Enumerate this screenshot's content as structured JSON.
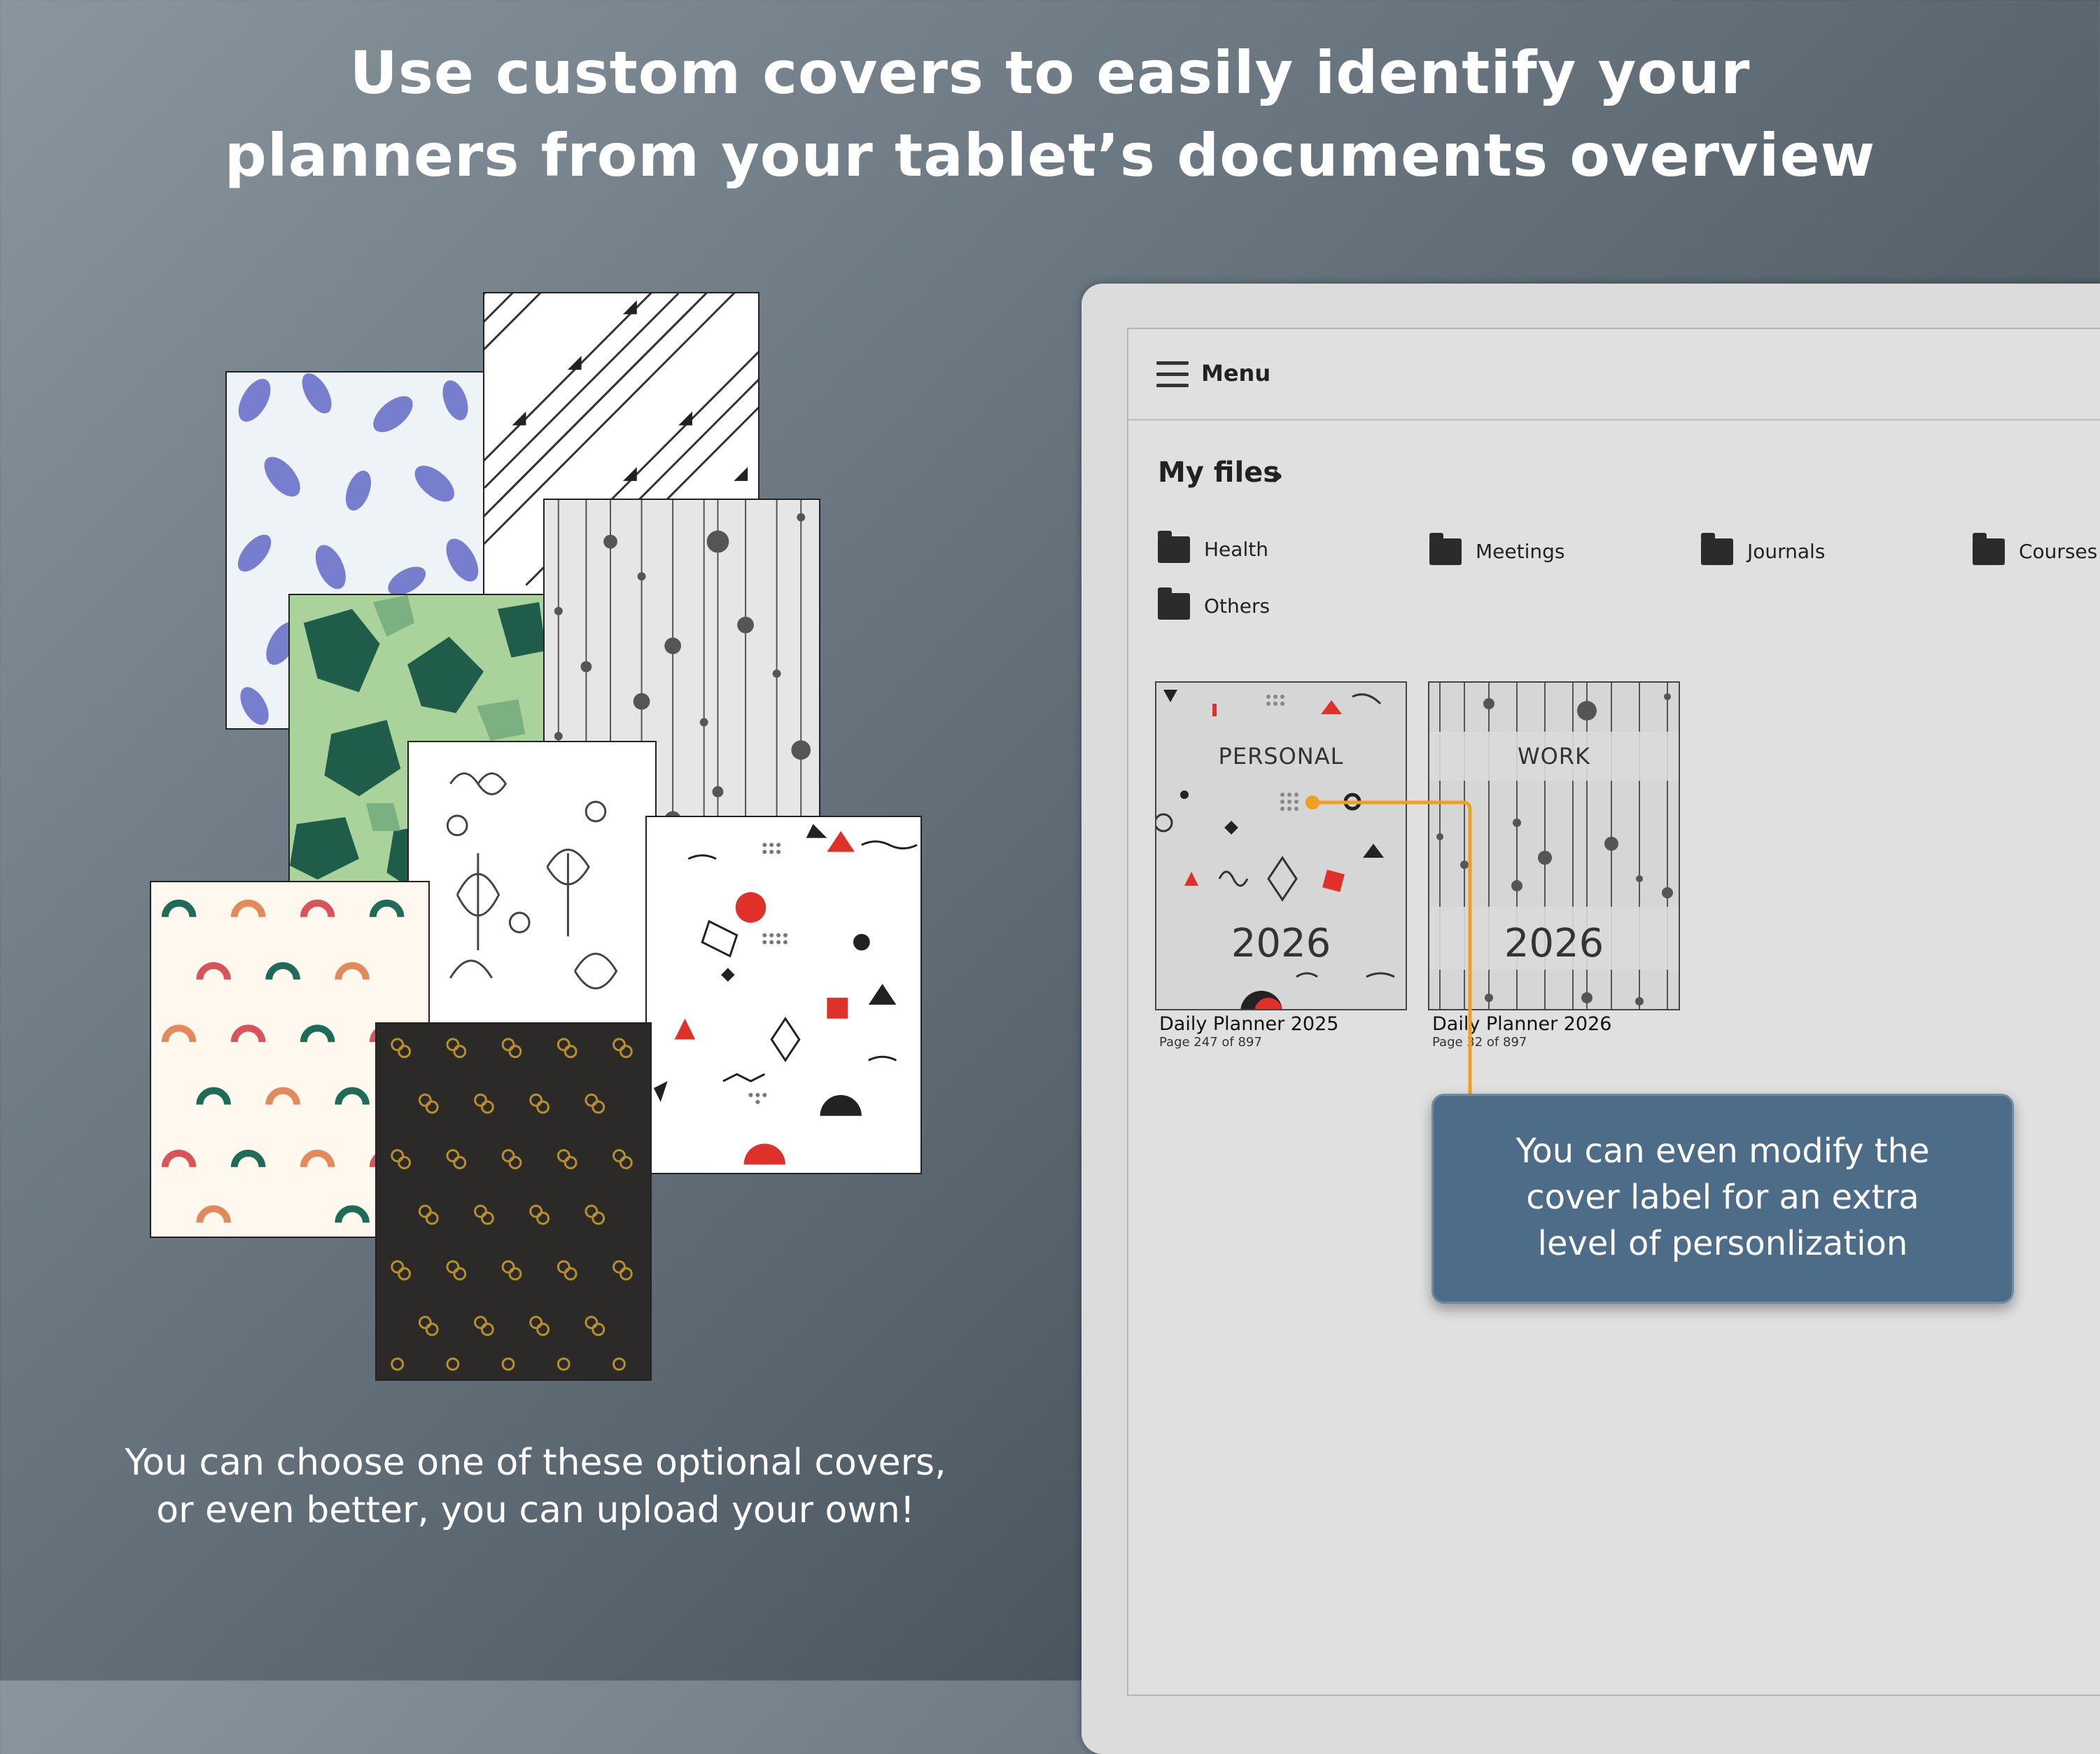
{
  "headline": {
    "line1": "Use custom covers to easily identify your",
    "line2": "planners from your tablet’s documents overview"
  },
  "caption": {
    "line1": "You can choose one of these optional covers,",
    "line2": "or even better, you can upload your own!"
  },
  "covers": [
    {
      "name": "blue leaves",
      "color": "#6a72c9"
    },
    {
      "name": "diagonal stripes",
      "color": "#333333"
    },
    {
      "name": "green camouflage",
      "color": "#2f6b4f"
    },
    {
      "name": "hanging dots",
      "color": "#555555"
    },
    {
      "name": "line art flowers",
      "color": "#444444"
    },
    {
      "name": "memphis shapes",
      "color": "#e0302a"
    },
    {
      "name": "rainbows",
      "color": "#1f6b5a"
    },
    {
      "name": "dark links",
      "color": "#b8902a"
    }
  ],
  "tablet": {
    "menu_label": "Menu",
    "breadcrumb": "My files",
    "breadcrumb_chevron": "›",
    "folders": [
      {
        "label": "Health"
      },
      {
        "label": "Meetings"
      },
      {
        "label": "Journals"
      },
      {
        "label": "Courses"
      },
      {
        "label": "Others"
      }
    ],
    "documents": [
      {
        "cover_label": "PERSONAL",
        "cover_year": "2026",
        "title": "Daily Planner 2025",
        "page": "Page 247 of 897"
      },
      {
        "cover_label": "WORK",
        "cover_year": "2026",
        "title": "Daily Planner 2026",
        "page": "Page 32 of 897"
      }
    ]
  },
  "callout": {
    "line1": "You can even modify the",
    "line2": "cover label for an extra",
    "line3": "level of personlization",
    "accent_color": "#f0a020"
  }
}
